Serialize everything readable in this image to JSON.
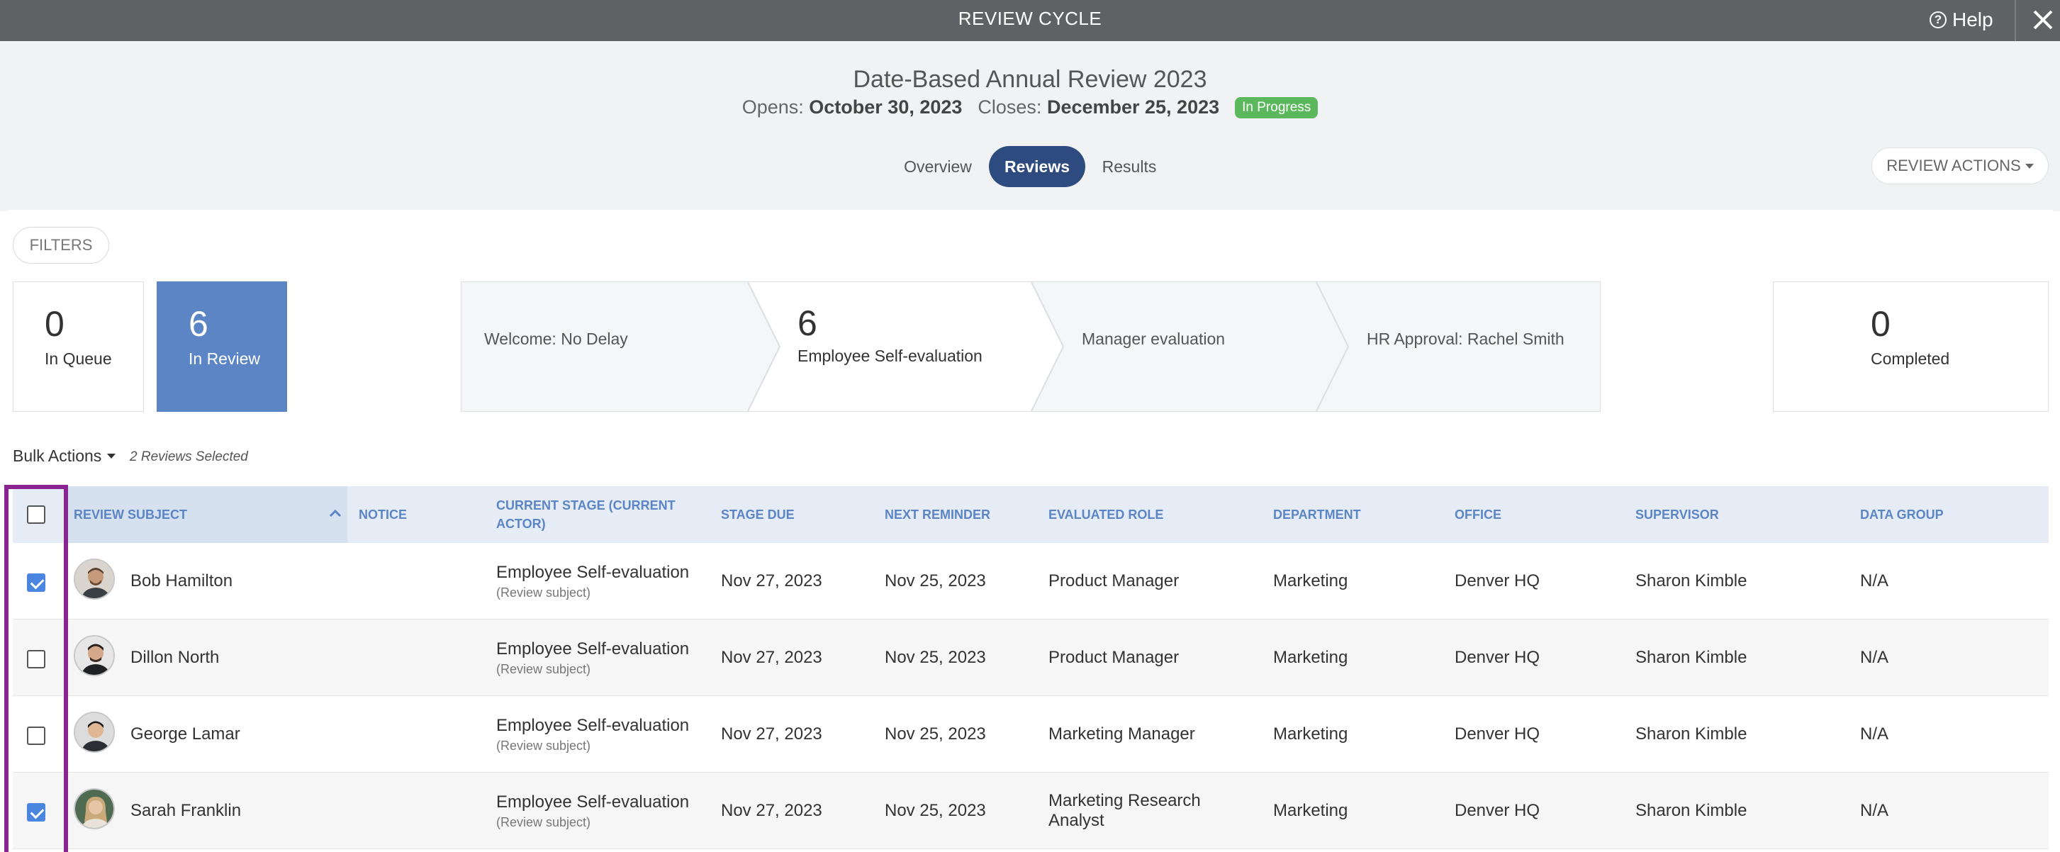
{
  "topbar": {
    "title": "REVIEW CYCLE",
    "help_label": "Help"
  },
  "header": {
    "cycle_title": "Date-Based Annual Review 2023",
    "opens_label": "Opens:",
    "opens_date": "October 30, 2023",
    "closes_label": "Closes:",
    "closes_date": "December 25, 2023",
    "status_badge": "In Progress",
    "status_color": "#5cb85c",
    "tabs": [
      {
        "label": "Overview",
        "active": false
      },
      {
        "label": "Reviews",
        "active": true
      },
      {
        "label": "Results",
        "active": false
      }
    ],
    "review_actions_label": "REVIEW ACTIONS"
  },
  "filters_label": "FILTERS",
  "stats": {
    "in_queue": {
      "count": "0",
      "label": "In Queue"
    },
    "in_review": {
      "count": "6",
      "label": "In Review"
    },
    "completed": {
      "count": "0",
      "label": "Completed"
    }
  },
  "pipeline": [
    {
      "label": "Welcome: No Delay",
      "count": ""
    },
    {
      "label": "Employee Self-evaluation",
      "count": "6"
    },
    {
      "label": "Manager evaluation",
      "count": ""
    },
    {
      "label": "HR Approval: Rachel Smith",
      "count": ""
    }
  ],
  "bulk_actions_label": "Bulk Actions",
  "selected_count_label": "2 Reviews Selected",
  "table": {
    "columns": [
      "REVIEW SUBJECT",
      "NOTICE",
      "CURRENT STAGE (CURRENT ACTOR)",
      "STAGE DUE",
      "NEXT REMINDER",
      "EVALUATED ROLE",
      "DEPARTMENT",
      "OFFICE",
      "SUPERVISOR",
      "DATA GROUP"
    ],
    "rows": [
      {
        "checked": true,
        "name": "Bob Hamilton",
        "stage": "Employee Self-evaluation",
        "actor": "(Review subject)",
        "stage_due": "Nov 27, 2023",
        "next_reminder": "Nov 25, 2023",
        "role": "Product Manager",
        "department": "Marketing",
        "office": "Denver HQ",
        "supervisor": "Sharon Kimble",
        "data_group": "N/A"
      },
      {
        "checked": false,
        "name": "Dillon North",
        "stage": "Employee Self-evaluation",
        "actor": "(Review subject)",
        "stage_due": "Nov 27, 2023",
        "next_reminder": "Nov 25, 2023",
        "role": "Product Manager",
        "department": "Marketing",
        "office": "Denver HQ",
        "supervisor": "Sharon Kimble",
        "data_group": "N/A"
      },
      {
        "checked": false,
        "name": "George Lamar",
        "stage": "Employee Self-evaluation",
        "actor": "(Review subject)",
        "stage_due": "Nov 27, 2023",
        "next_reminder": "Nov 25, 2023",
        "role": "Marketing Manager",
        "department": "Marketing",
        "office": "Denver HQ",
        "supervisor": "Sharon Kimble",
        "data_group": "N/A"
      },
      {
        "checked": true,
        "name": "Sarah Franklin",
        "stage": "Employee Self-evaluation",
        "actor": "(Review subject)",
        "stage_due": "Nov 27, 2023",
        "next_reminder": "Nov 25, 2023",
        "role": "Marketing Research Analyst",
        "department": "Marketing",
        "office": "Denver HQ",
        "supervisor": "Sharon Kimble",
        "data_group": "N/A"
      }
    ]
  },
  "colors": {
    "accent": "#2e4b7f",
    "stat_blue": "#5b85c4",
    "header_text": "#5b85c4",
    "highlight": "#8a2491"
  }
}
